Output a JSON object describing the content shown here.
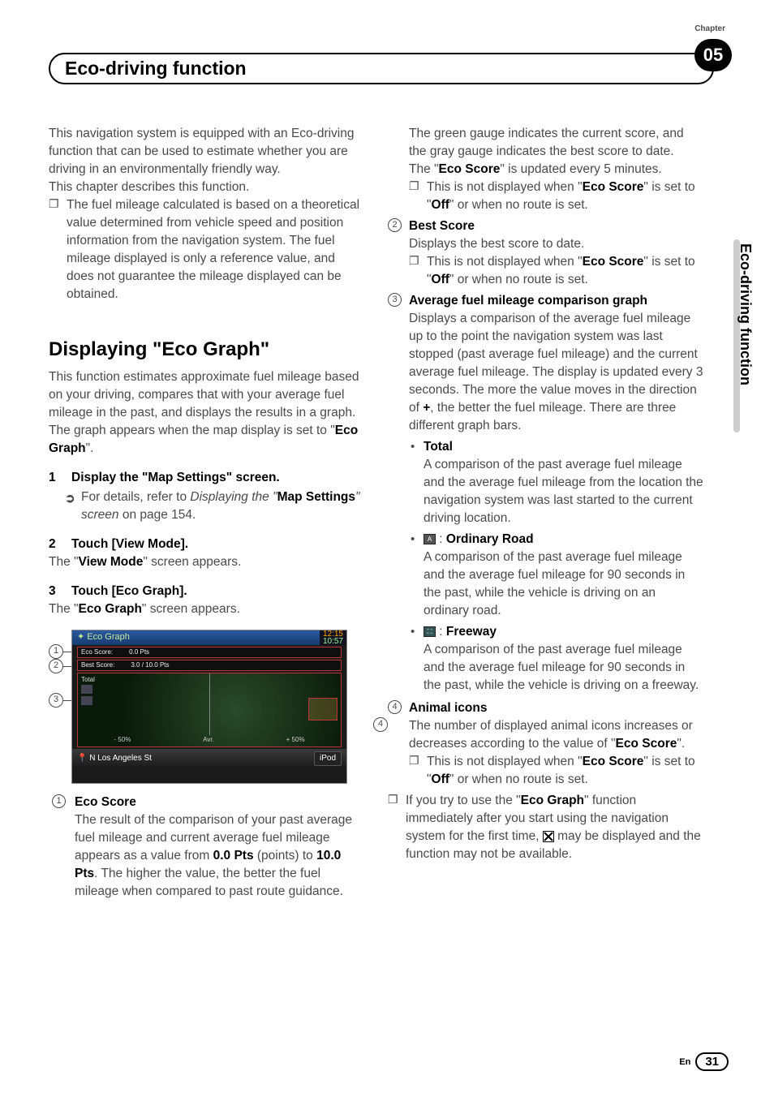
{
  "chapter": {
    "label": "Chapter",
    "number": "05"
  },
  "title": "Eco-driving function",
  "side_tab": "Eco-driving function",
  "col1": {
    "intro1": "This navigation system is equipped with an Eco-driving function that can be used to estimate whether you are driving in an environmentally friendly way.",
    "intro2": "This chapter describes this function.",
    "bullet1": "The fuel mileage calculated is based on a theoretical value determined from vehicle speed and position information from the navigation system. The fuel mileage displayed is only a reference value, and does not guarantee the mileage displayed can be obtained.",
    "h2a": "Displaying ",
    "h2b": "\"Eco Graph\"",
    "p_after_h2": "This function estimates approximate fuel mileage based on your driving, compares that with your average fuel mileage in the past, and displays the results in a graph.",
    "p_after_h2b_a": "The graph appears when the map display is set to \"",
    "p_after_h2b_bold": "Eco Graph",
    "p_after_h2b_c": "\".",
    "step1": {
      "num": "1",
      "label": "Display the \"Map Settings\" screen.",
      "ref_a": "For details, refer to ",
      "ref_ital": "Displaying the \"",
      "ref_bold": "Map Settings",
      "ref_ital2": "\" screen",
      "ref_c": " on page 154."
    },
    "step2": {
      "num": "2",
      "label": "Touch [View Mode].",
      "text_a": "The \"",
      "text_bold": "View Mode",
      "text_c": "\" screen appears."
    },
    "step3": {
      "num": "3",
      "label": "Touch [Eco Graph].",
      "text_a": "The \"",
      "text_bold": "Eco Graph",
      "text_c": "\" screen appears."
    },
    "fig": {
      "header_left": "Eco Graph",
      "time1": "12:15",
      "time2": "10:57",
      "row1_a": "Eco Score:",
      "row1_b": "0.0 Pts",
      "row2_a": "Best Score:",
      "row2_b": "3.0 / 10.0 Pts",
      "total": "Total",
      "minus": "- 50%",
      "avr": "Avr.",
      "plus": "+ 50%",
      "bottom_left": "N Los Angeles St",
      "bottom_right": "iPod"
    },
    "item1": {
      "num": "1",
      "title": "Eco Score",
      "body_a": "The result of the comparison of your past average fuel mileage and current average fuel mileage appears as a value from ",
      "body_bold1": "0.0 Pts",
      "body_b": " (points) to ",
      "body_bold2": "10.0 Pts",
      "body_c": ". The higher the value, the better the fuel mileage when compared to past route guidance."
    }
  },
  "col2": {
    "top_a": "The green gauge indicates the current score, and the gray gauge indicates the best score to date.",
    "top_b_a": "The \"",
    "top_b_bold": "Eco Score",
    "top_b_c": "\" is updated every 5 minutes.",
    "sq1_a": "This is not displayed when \"",
    "sq1_bold": "Eco Score",
    "sq1_b": "\" is set to \"",
    "sq1_bold2": "Off",
    "sq1_c": "\" or when no route is set.",
    "item2": {
      "num": "2",
      "title": "Best Score",
      "body": "Displays the best score to date.",
      "sq_a": "This is not displayed when \"",
      "sq_bold": "Eco Score",
      "sq_b": "\" is set to \"",
      "sq_bold2": "Off",
      "sq_c": "\" or when no route is set."
    },
    "item3": {
      "num": "3",
      "title": "Average fuel mileage comparison graph",
      "body_a": "Displays a comparison of the average fuel mileage up to the point the navigation system was last stopped (past average fuel mileage) and the current average fuel mileage. The display is updated every 3 seconds. The more the value moves in the direction of ",
      "body_plus": "+",
      "body_b": ", the better the fuel mileage. There are three different graph bars.",
      "total": {
        "title": "Total",
        "body": "A comparison of the past average fuel mileage and the average fuel mileage from the location the navigation system was last started to the current driving location."
      },
      "ord": {
        "title": "Ordinary Road",
        "body": "A comparison of the past average fuel mileage and the average fuel mileage for 90 seconds in the past, while the vehicle is driving on an ordinary road."
      },
      "fwy": {
        "title": "Freeway",
        "body": "A comparison of the past average fuel mileage and the average fuel mileage for 90 seconds in the past, while the vehicle is driving on a freeway."
      }
    },
    "item4": {
      "num": "4",
      "title": "Animal icons",
      "body_a": "The number of displayed animal icons increases or decreases according to the value of \"",
      "body_bold": "Eco Score",
      "body_b": "\".",
      "sq_a": "This is not displayed when \"",
      "sq_bold": "Eco Score",
      "sq_b": "\" is set to \"",
      "sq_bold2": "Off",
      "sq_c": "\" or when no route is set."
    },
    "last_sq_a": "If you try to use the \"",
    "last_sq_bold": "Eco Graph",
    "last_sq_b": "\" function immediately after you start using the navigation system for the first time, ",
    "last_sq_c": " may be displayed and the function may not be available."
  },
  "footer": {
    "en": "En",
    "page": "31"
  }
}
